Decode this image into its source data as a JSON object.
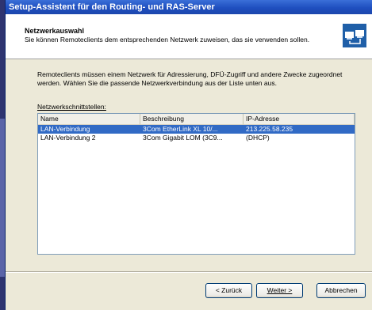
{
  "window": {
    "title": "Setup-Assistent für den Routing- und RAS-Server"
  },
  "header": {
    "title": "Netzwerkauswahl",
    "subtitle": "Sie können Remoteclients dem entsprechenden Netzwerk zuweisen, das sie verwenden sollen.",
    "icon": "network-wizard-icon"
  },
  "body": {
    "description": "Remoteclients müssen einem Netzwerk für Adressierung, DFÜ-Zugriff und andere Zwecke zugeordnet werden. Wählen Sie die passende Netzwerkverbindung aus der Liste unten aus.",
    "list_label": "Netzwerkschnittstellen:"
  },
  "table": {
    "columns": [
      "Name",
      "Beschreibung",
      "IP-Adresse"
    ],
    "rows": [
      {
        "name": "LAN-Verbindung",
        "description": "3Com EtherLink XL 10/...",
        "ip": "213.225.58.235",
        "selected": true
      },
      {
        "name": "LAN-Verbindung 2",
        "description": "3Com Gigabit LOM (3C9...",
        "ip": "(DHCP)",
        "selected": false
      }
    ]
  },
  "buttons": {
    "back": "< Zurück",
    "next": "Weiter >",
    "cancel": "Abbrechen"
  },
  "colors": {
    "titlebar": "#1f4fbf",
    "selection": "#316ac5",
    "dialog_bg": "#ece9d8"
  }
}
